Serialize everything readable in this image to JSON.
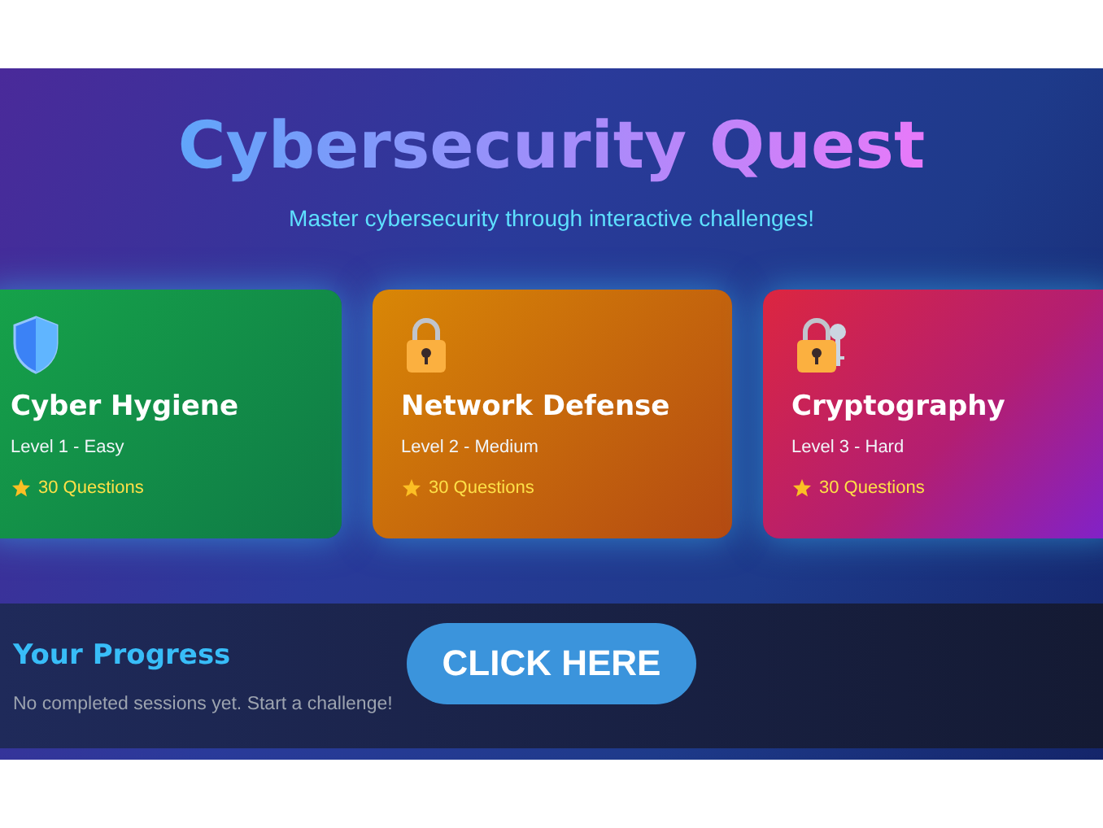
{
  "header": {
    "title": "Cybersecurity Quest",
    "subtitle": "Master cybersecurity through interactive challenges!"
  },
  "challenges": [
    {
      "title": "Cyber Hygiene",
      "level": "Level 1 - Easy",
      "questions": "30 Questions"
    },
    {
      "title": "Network Defense",
      "level": "Level 2 - Medium",
      "questions": "30 Questions"
    },
    {
      "title": "Cryptography",
      "level": "Level 3 - Hard",
      "questions": "30 Questions"
    }
  ],
  "progress": {
    "title": "Your Progress",
    "message": "No completed sessions yet. Start a challenge!"
  },
  "cta_button": "CLICK HERE"
}
